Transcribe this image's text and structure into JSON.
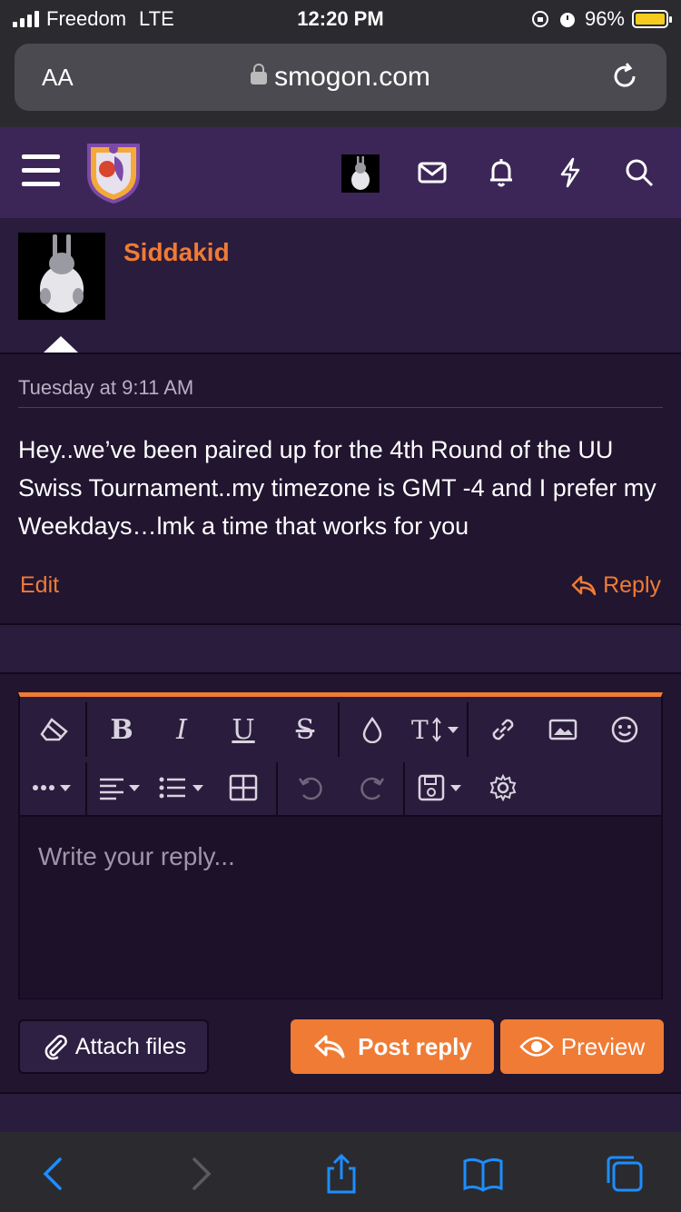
{
  "status_bar": {
    "carrier": "Freedom",
    "network": "LTE",
    "time": "12:20 PM",
    "battery": "96%",
    "battery_color": "#f5cc1d"
  },
  "address_bar": {
    "text_size_label": "AA",
    "url": "smogon.com"
  },
  "site_header": {
    "icons": [
      "menu-icon",
      "site-logo",
      "user-avatar",
      "inbox-icon",
      "bell-icon",
      "lightning-icon",
      "search-icon"
    ]
  },
  "post": {
    "username": "Siddakid",
    "date": "Tuesday at 9:11 AM",
    "body": "Hey..we’ve been paired up for the 4th Round of the UU Swiss Tournament..my timezone is GMT -4 and I prefer my Weekdays…lmk a time that works for you",
    "edit_label": "Edit",
    "reply_label": "Reply"
  },
  "editor": {
    "placeholder": "Write your reply...",
    "toolbar_row1": [
      "eraser-icon",
      "bold-icon",
      "italic-icon",
      "underline-icon",
      "strikethrough-icon",
      "color-drop-icon",
      "font-size-icon",
      "link-icon",
      "image-icon",
      "smiley-icon"
    ],
    "toolbar_row2": [
      "more-icon",
      "align-icon",
      "list-icon",
      "table-icon",
      "undo-icon",
      "redo-icon",
      "save-draft-icon",
      "settings-icon"
    ],
    "accent_color": "#f07b34"
  },
  "actions": {
    "attach_label": "Attach files",
    "post_reply_label": "Post reply",
    "preview_label": "Preview"
  },
  "theme": {
    "header_bg": "#3c2658",
    "page_bg": "#2a1c3d",
    "accent": "#f07b34",
    "safari_blue": "#1d8dff"
  }
}
